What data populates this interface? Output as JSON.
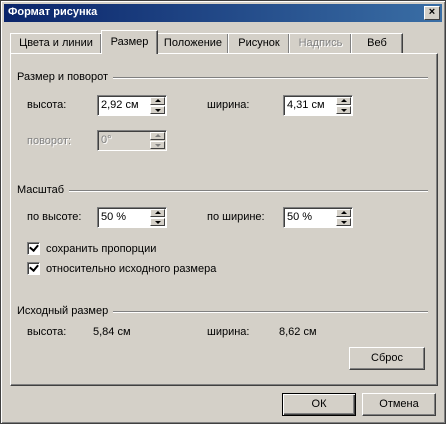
{
  "window": {
    "title": "Формат рисунка",
    "close_glyph": "×"
  },
  "tabs": [
    {
      "label": "Цвета и линии"
    },
    {
      "label": "Размер"
    },
    {
      "label": "Положение"
    },
    {
      "label": "Рисунок"
    },
    {
      "label": "Надпись"
    },
    {
      "label": "Веб"
    }
  ],
  "size_rotate": {
    "title": "Размер и поворот",
    "height_label": "высота:",
    "height_value": "2,92 см",
    "width_label": "ширина:",
    "width_value": "4,31 см",
    "rotation_label": "поворот:",
    "rotation_value": "0°"
  },
  "scale": {
    "title": "Масштаб",
    "by_height_label": "по высоте:",
    "by_height_value": "50 %",
    "by_width_label": "по ширине:",
    "by_width_value": "50 %",
    "keep_ratio_label": "сохранить пропорции",
    "relative_label": "относительно исходного размера"
  },
  "original": {
    "title": "Исходный размер",
    "height_label": "высота:",
    "height_value": "5,84 см",
    "width_label": "ширина:",
    "width_value": "8,62 см",
    "reset_label": "Сброс"
  },
  "footer": {
    "ok_label": "ОК",
    "cancel_label": "Отмена"
  }
}
